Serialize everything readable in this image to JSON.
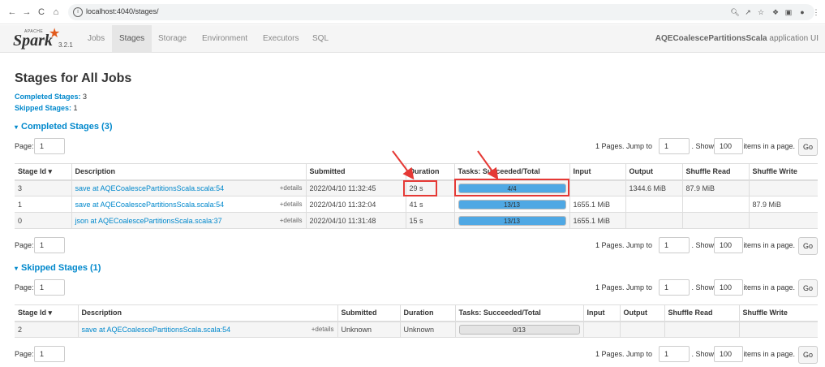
{
  "browser": {
    "url": "localhost:4040/stages/",
    "nav": {
      "back": "←",
      "forward": "→",
      "reload": "C",
      "home": "⌂"
    },
    "icons": [
      "zoom-icon",
      "share-icon",
      "star-icon",
      "puzzle-icon",
      "sidebar-icon",
      "profile-icon",
      "menu-icon"
    ]
  },
  "spark": {
    "logo_word": "Spark",
    "logo_apache": "APACHE",
    "version": "3.2.1",
    "tabs": [
      "Jobs",
      "Stages",
      "Storage",
      "Environment",
      "Executors",
      "SQL"
    ],
    "active_tab": "Stages",
    "app_name": "AQECoalescePartitionsScala",
    "app_suffix": "application UI"
  },
  "page": {
    "title": "Stages for All Jobs",
    "completed_label": "Completed Stages:",
    "completed_count": "3",
    "skipped_label": "Skipped Stages:",
    "skipped_count": "1"
  },
  "completed": {
    "section_title": "Completed Stages (3)",
    "caret": "▾",
    "pager": {
      "page_label": "Page:",
      "page_value": "1",
      "pages_text": "1 Pages. Jump to",
      "jump_value": "1",
      "show_text": ". Show",
      "show_value": "100",
      "items_text": "items in a page.",
      "go": "Go"
    },
    "headers": [
      "Stage Id ▾",
      "Description",
      "Submitted",
      "Duration",
      "Tasks: Succeeded/Total",
      "Input",
      "Output",
      "Shuffle Read",
      "Shuffle Write"
    ],
    "rows": [
      {
        "id": "3",
        "desc": "save at AQECoalescePartitionsScala.scala:54",
        "details": "+details",
        "submitted": "2022/04/10 11:32:45",
        "duration": "29 s",
        "tasks": "4/4",
        "progress": 1.0,
        "input": "",
        "output": "1344.6 MiB",
        "shuffle_read": "87.9 MiB",
        "shuffle_write": ""
      },
      {
        "id": "1",
        "desc": "save at AQECoalescePartitionsScala.scala:54",
        "details": "+details",
        "submitted": "2022/04/10 11:32:04",
        "duration": "41 s",
        "tasks": "13/13",
        "progress": 1.0,
        "input": "1655.1 MiB",
        "output": "",
        "shuffle_read": "",
        "shuffle_write": "87.9 MiB"
      },
      {
        "id": "0",
        "desc": "json at AQECoalescePartitionsScala.scala:37",
        "details": "+details",
        "submitted": "2022/04/10 11:31:48",
        "duration": "15 s",
        "tasks": "13/13",
        "progress": 1.0,
        "input": "1655.1 MiB",
        "output": "",
        "shuffle_read": "",
        "shuffle_write": ""
      }
    ]
  },
  "skipped": {
    "section_title": "Skipped Stages (1)",
    "caret": "▾",
    "headers": [
      "Stage Id ▾",
      "Description",
      "Submitted",
      "Duration",
      "Tasks: Succeeded/Total",
      "Input",
      "Output",
      "Shuffle Read",
      "Shuffle Write"
    ],
    "rows": [
      {
        "id": "2",
        "desc": "save at AQECoalescePartitionsScala.scala:54",
        "details": "+details",
        "submitted": "Unknown",
        "duration": "Unknown",
        "tasks": "0/13",
        "progress": 0.0,
        "input": "",
        "output": "",
        "shuffle_read": "",
        "shuffle_write": ""
      }
    ]
  },
  "colors": {
    "link": "#0088cc",
    "progress": "#4fa8e4",
    "annotation": "#e53935",
    "spark_orange": "#e25a1c"
  }
}
